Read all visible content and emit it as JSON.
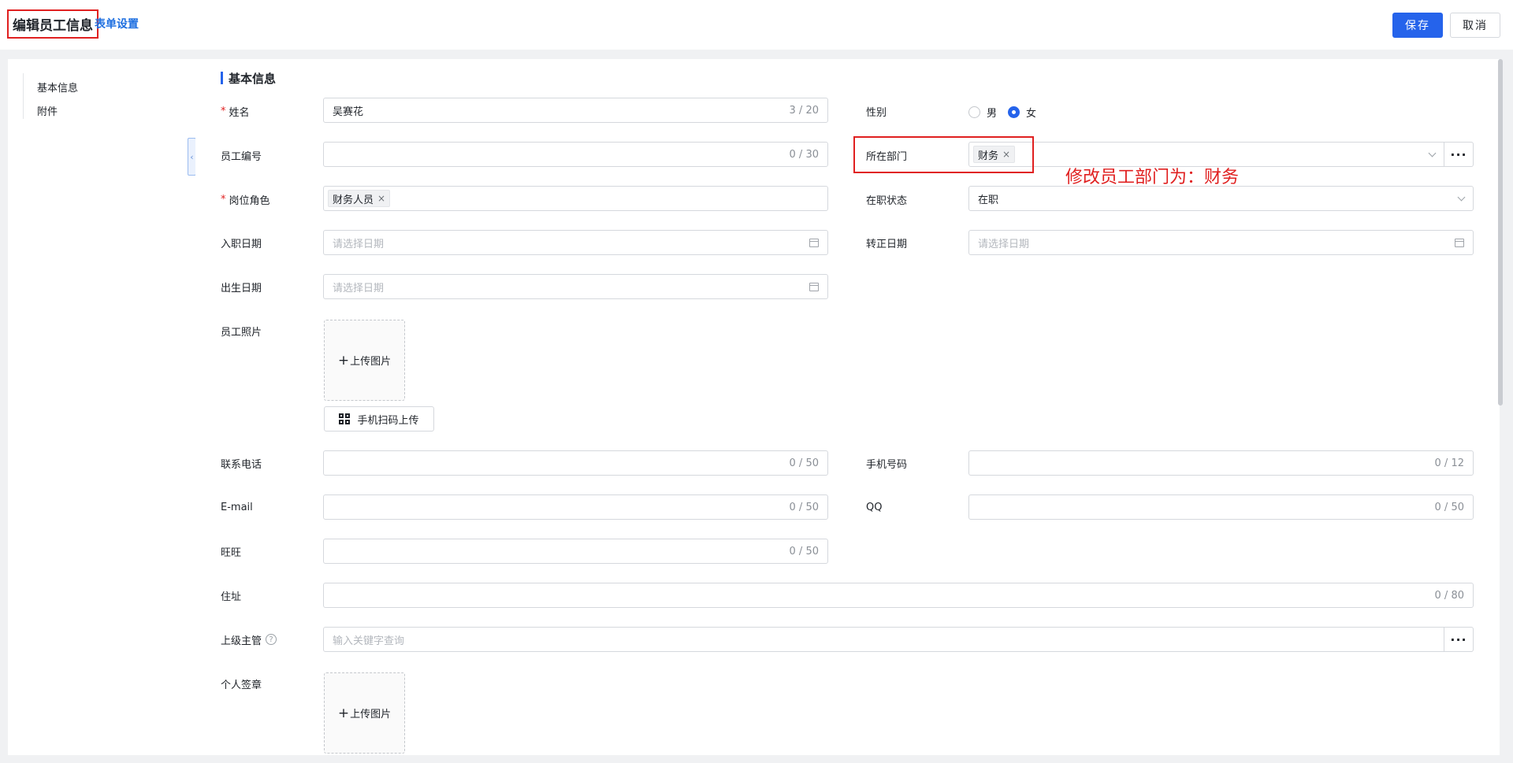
{
  "header": {
    "title": "编辑员工信息",
    "form_settings": "表单设置",
    "save": "保存",
    "cancel": "取消"
  },
  "sidebar": {
    "items": [
      {
        "label": "基本信息"
      },
      {
        "label": "附件"
      }
    ]
  },
  "section": {
    "title": "基本信息"
  },
  "fields": {
    "name": {
      "label": "姓名",
      "value": "吴赛花",
      "count": "3 / 20",
      "required": true
    },
    "gender": {
      "label": "性别",
      "options": [
        "男",
        "女"
      ],
      "selected": "女"
    },
    "employee_no": {
      "label": "员工编号",
      "value": "",
      "count": "0 / 30"
    },
    "department": {
      "label": "所在部门",
      "tag": "财务"
    },
    "role": {
      "label": "岗位角色",
      "tag": "财务人员",
      "required": true
    },
    "status": {
      "label": "在职状态",
      "value": "在职"
    },
    "hire_date": {
      "label": "入职日期",
      "placeholder": "请选择日期"
    },
    "regular_date": {
      "label": "转正日期",
      "placeholder": "请选择日期"
    },
    "birth_date": {
      "label": "出生日期",
      "placeholder": "请选择日期"
    },
    "photo": {
      "label": "员工照片",
      "upload": "上传图片",
      "scan": "手机扫码上传"
    },
    "phone": {
      "label": "联系电话",
      "count": "0 / 50"
    },
    "mobile": {
      "label": "手机号码",
      "count": "0 / 12"
    },
    "email": {
      "label": "E-mail",
      "count": "0 / 50"
    },
    "qq": {
      "label": "QQ",
      "count": "0 / 50"
    },
    "wangwang": {
      "label": "旺旺",
      "count": "0 / 50"
    },
    "address": {
      "label": "住址",
      "count": "0 / 80"
    },
    "supervisor": {
      "label": "上级主管",
      "placeholder": "输入关键字查询"
    },
    "seal": {
      "label": "个人签章",
      "upload": "上传图片"
    }
  },
  "annotation": {
    "text": "修改员工部门为：财务",
    "color": "#e02020"
  },
  "colors": {
    "accent": "#2563eb",
    "required": "#e02020",
    "link": "#1e6fe0"
  },
  "icons": {
    "more": "ellipsis-icon",
    "date": "calendar-icon",
    "select": "chevron-down-icon",
    "qr": "qr-code-icon",
    "help": "question-circle-icon",
    "upload": "plus-icon"
  }
}
